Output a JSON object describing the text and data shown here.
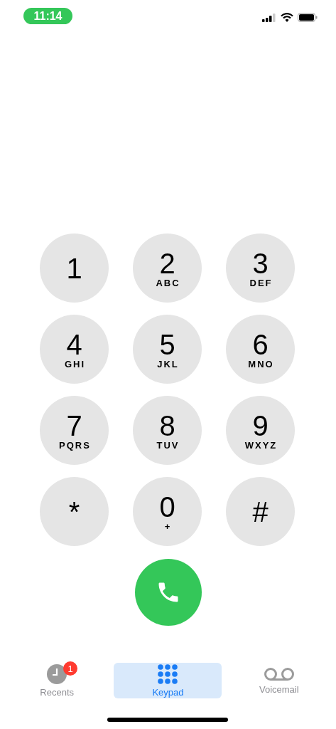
{
  "status_bar": {
    "time": "11:14"
  },
  "keypad": [
    {
      "digit": "1"
    },
    {
      "digit": "2",
      "letters": "ABC"
    },
    {
      "digit": "3",
      "letters": "DEF"
    },
    {
      "digit": "4",
      "letters": "GHI"
    },
    {
      "digit": "5",
      "letters": "JKL"
    },
    {
      "digit": "6",
      "letters": "MNO"
    },
    {
      "digit": "7",
      "letters": "PQRS"
    },
    {
      "digit": "8",
      "letters": "TUV"
    },
    {
      "digit": "9",
      "letters": "WXYZ"
    },
    {
      "digit": "*"
    },
    {
      "digit": "0",
      "letters": "+"
    },
    {
      "digit": "#"
    }
  ],
  "tabs": [
    {
      "label": "Recents",
      "kind": "recents",
      "selected": false,
      "badge": "1"
    },
    {
      "label": "Keypad",
      "kind": "keypad",
      "selected": true
    },
    {
      "label": "Voicemail",
      "kind": "voicemail",
      "selected": false
    }
  ]
}
